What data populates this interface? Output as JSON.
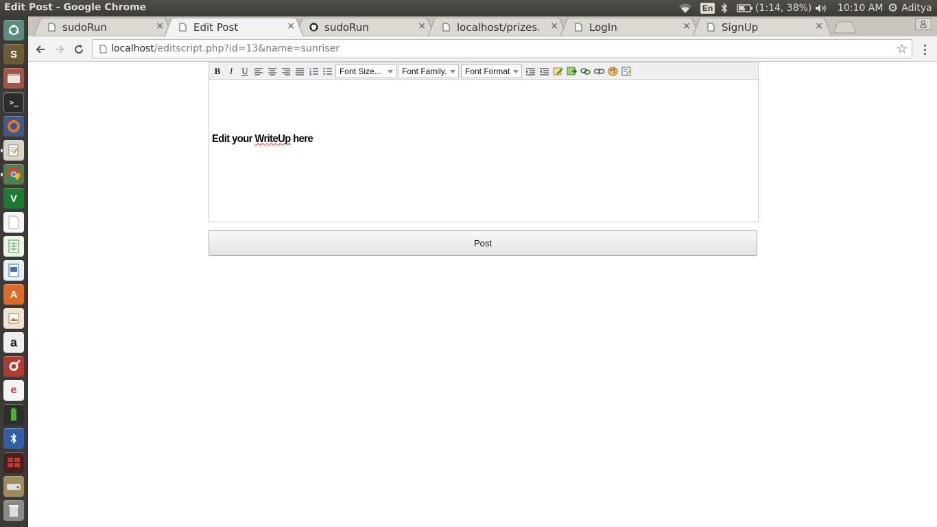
{
  "window": {
    "title": "Edit Post - Google Chrome"
  },
  "panel": {
    "input_method": "En",
    "battery": "(1:14, 38%)",
    "clock": "10:10 AM",
    "user": "Aditya"
  },
  "launcher": {
    "items": [
      "dash-icon",
      "sublime-text-icon",
      "file-manager-icon",
      "terminal-icon",
      "firefox-icon",
      "text-editor-icon",
      "chrome-icon",
      "vim-icon",
      "document-icon",
      "spreadsheet-icon",
      "presentation-icon",
      "software-center-icon",
      "image-viewer-icon",
      "amazon-icon",
      "system-settings-icon",
      "email-client-icon",
      "battery-app-icon",
      "bluetooth-app-icon",
      "workspace-switcher-icon",
      "drive-icon",
      "trash-icon"
    ]
  },
  "tabs": [
    {
      "title": "sudoRun",
      "icon": "page-icon",
      "active": false
    },
    {
      "title": "Edit Post",
      "icon": "page-icon",
      "active": true
    },
    {
      "title": "sudoRun",
      "icon": "github-icon",
      "active": false
    },
    {
      "title": "localhost/prizes.htm",
      "icon": "page-icon",
      "active": false
    },
    {
      "title": "LogIn",
      "icon": "page-icon",
      "active": false
    },
    {
      "title": "SignUp",
      "icon": "page-icon",
      "active": false
    }
  ],
  "tab_close_glyph": "×",
  "address_bar": {
    "host": "localhost",
    "path": "/editscript.php?id=13&name=sunriser"
  },
  "editor": {
    "toolbar": {
      "bold": "B",
      "italic": "I",
      "underline": "U",
      "font_size": "Font Size...",
      "font_family": "Font Family.",
      "font_format": "Font Format"
    },
    "content_prefix": "Edit your ",
    "content_misspelled": "WriteUp",
    "content_suffix": " here"
  },
  "post_button": {
    "label": "Post"
  },
  "colors": {
    "panel_bg": "#3c3b37",
    "launcher_bg": "#3b3a36",
    "tabstrip_bg": "#c9c4bd",
    "active_tab_bg": "#f2f2f2"
  }
}
